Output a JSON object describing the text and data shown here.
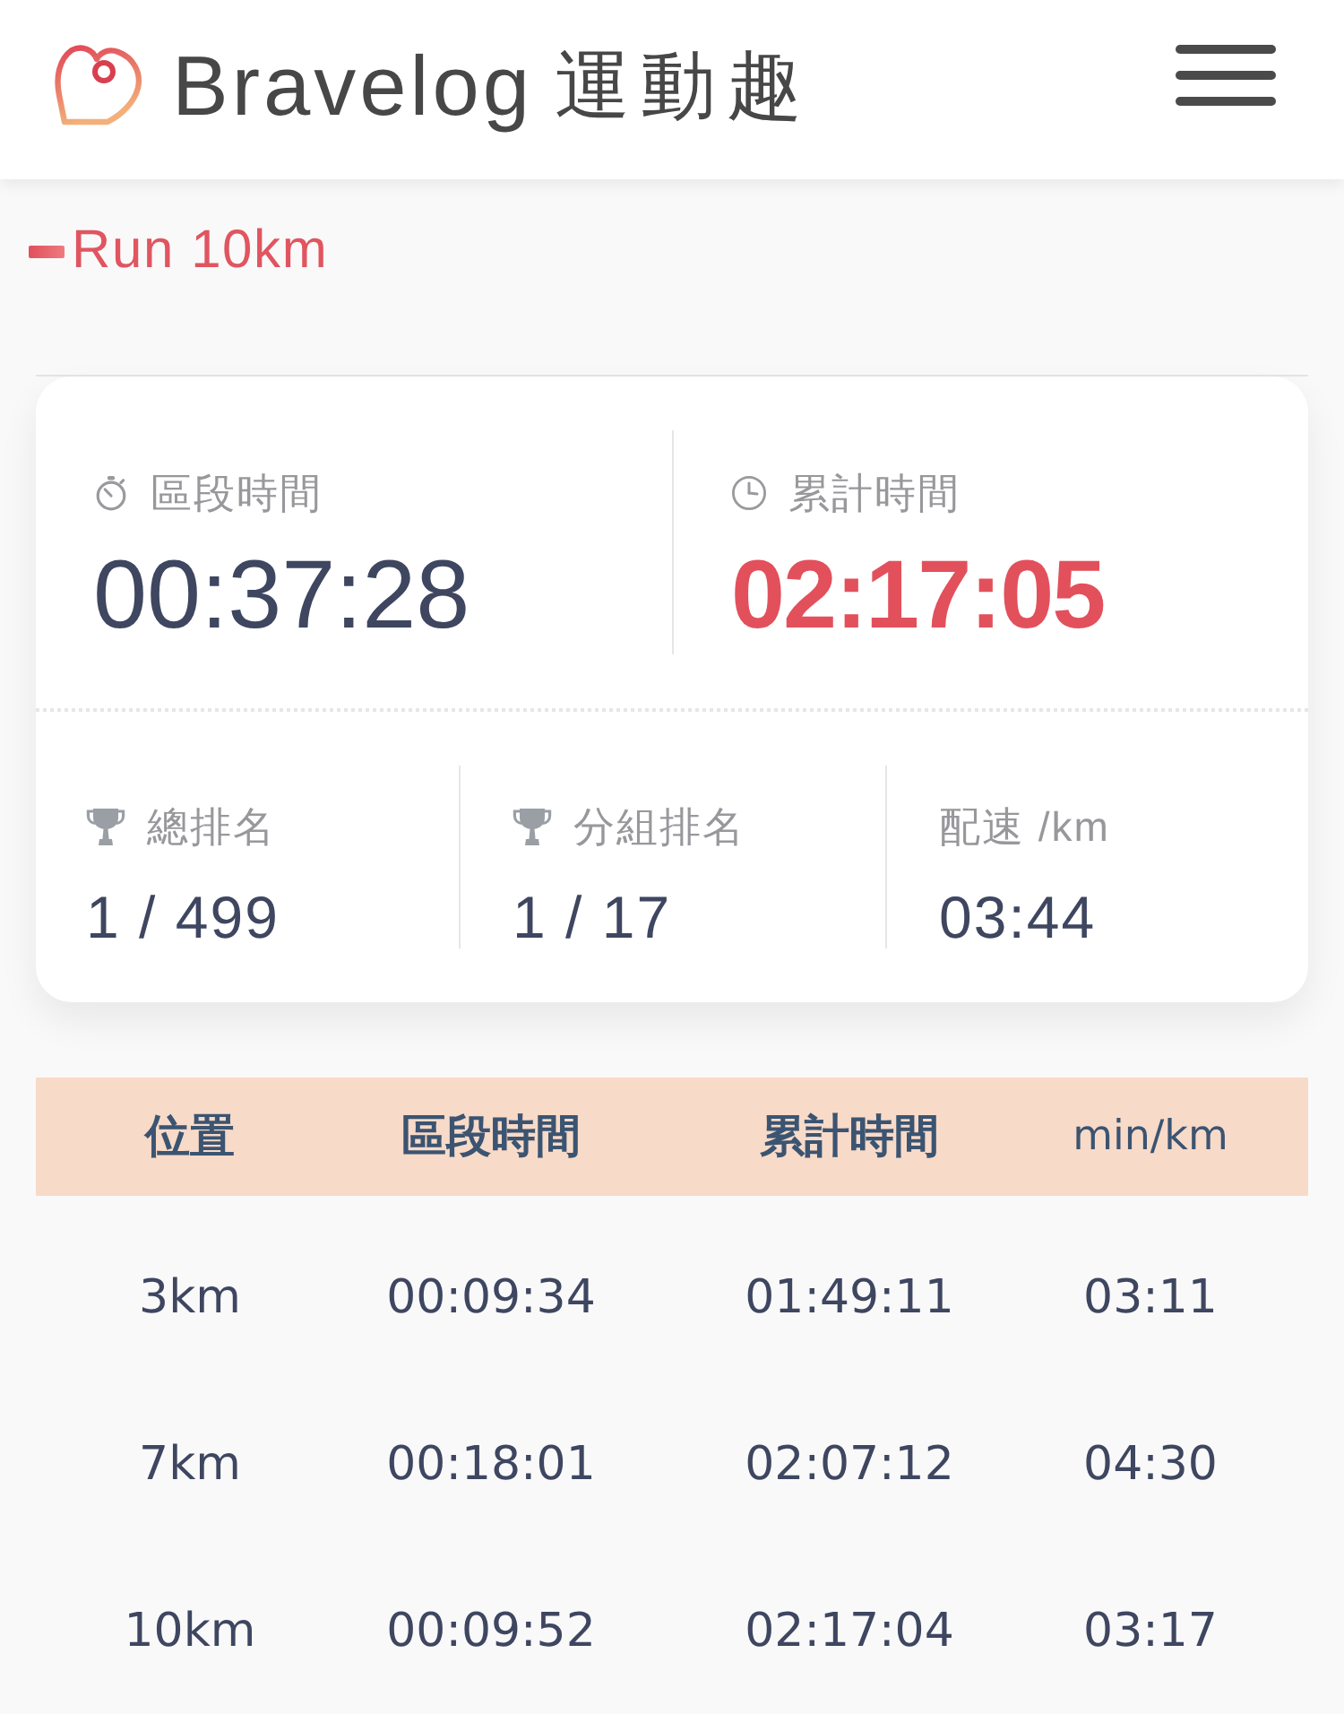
{
  "header": {
    "brand": "Bravelog",
    "brand_chinese": "運動趣"
  },
  "event": {
    "title": "Run 10km"
  },
  "summary": {
    "primary": [
      {
        "kind": "split",
        "label": "區段時間",
        "value": "00:37:28",
        "highlight": false
      },
      {
        "kind": "total",
        "label": "累計時間",
        "value": "02:17:05",
        "highlight": true
      }
    ],
    "secondary": [
      {
        "kind": "rank",
        "label": "總排名",
        "value": "1 / 499"
      },
      {
        "kind": "rank",
        "label": "分組排名",
        "value": "1 / 17"
      },
      {
        "kind": "pace",
        "label": "配速 /km",
        "value": "03:44"
      }
    ]
  },
  "splits": {
    "columns": [
      "位置",
      "區段時間",
      "累計時間",
      "min/km"
    ],
    "rows": [
      [
        "3km",
        "00:09:34",
        "01:49:11",
        "03:11"
      ],
      [
        "7km",
        "00:18:01",
        "02:07:12",
        "04:30"
      ],
      [
        "10km",
        "00:09:52",
        "02:17:04",
        "03:17"
      ]
    ]
  }
}
